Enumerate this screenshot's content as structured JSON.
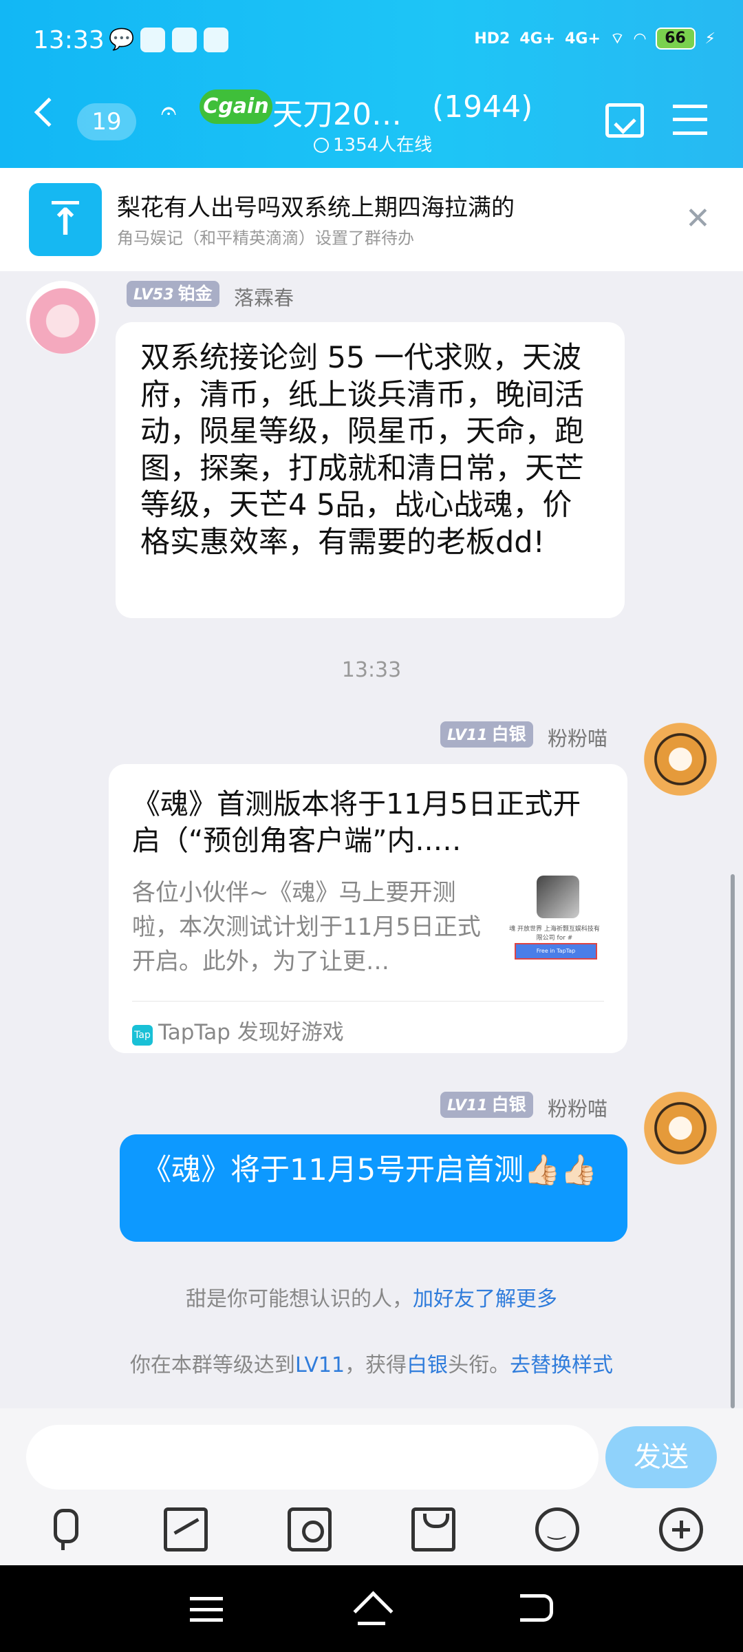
{
  "status_bar": {
    "time": "13:33",
    "battery": "66",
    "network_label_1": "HD2",
    "network_label_2": "4G+",
    "network_label_3": "4G+"
  },
  "header": {
    "unread_count": "19",
    "logo_text": "Cgain",
    "group_name": "天刀20…",
    "group_member_count": "(1944)",
    "online_text": "1354人在线"
  },
  "notice": {
    "title": "梨花有人出号吗双系统上期四海拉满的",
    "subtitle": "角马娱记（和平精英滴滴）设置了群待办"
  },
  "messages": [
    {
      "level": "LV53",
      "title": "铂金",
      "nickname": "落霖春",
      "text": "双系统接论剑 55 一代求败，天波府，清币，纸上谈兵清币，晚间活动，陨星等级，陨星币，天命，跑图，探案，打成就和清日常，天芒等级，天芒4 5品，战心战魂，价格实惠效率，有需要的老板dd!"
    },
    {
      "timestamp": "13:33"
    },
    {
      "level": "LV11",
      "title": "白银",
      "nickname": "粉粉喵",
      "card_title": "《魂》首测版本将于11月5日正式开启（“预创角客户端”内..…",
      "card_desc": "各位小伙伴~《魂》马上要开测啦，本次测试计划于11月5日正式开启。此外，为了让更…",
      "card_thumb_label": "魂 开放世界 上海祈颢互娱科技有限公司 for #",
      "card_thumb_button": "Free in TapTap",
      "card_source_icon": "Tap",
      "card_source": "TapTap 发现好游戏"
    },
    {
      "level": "LV11",
      "title": "白银",
      "nickname": "粉粉喵",
      "text": "《魂》将于11月5号开启首测👍🏻👍🏻"
    }
  ],
  "system_tips": {
    "tip1_text": "甜是你可能想认识的人，",
    "tip1_link": "加好友了解更多",
    "tip2_prefix": "你在本群等级达到",
    "tip2_level": "LV11",
    "tip2_mid": "，获得",
    "tip2_title": "白银",
    "tip2_suffix": "头衔。",
    "tip2_link": "去替换样式"
  },
  "input_bar": {
    "placeholder": "",
    "send_label": "发送"
  },
  "colors": {
    "header_bg": "#12b7f5",
    "self_bubble": "#0d99ff",
    "link": "#2f7cdb",
    "send_button": "#8fd2fb",
    "badge_bg": "#a9aec6"
  }
}
